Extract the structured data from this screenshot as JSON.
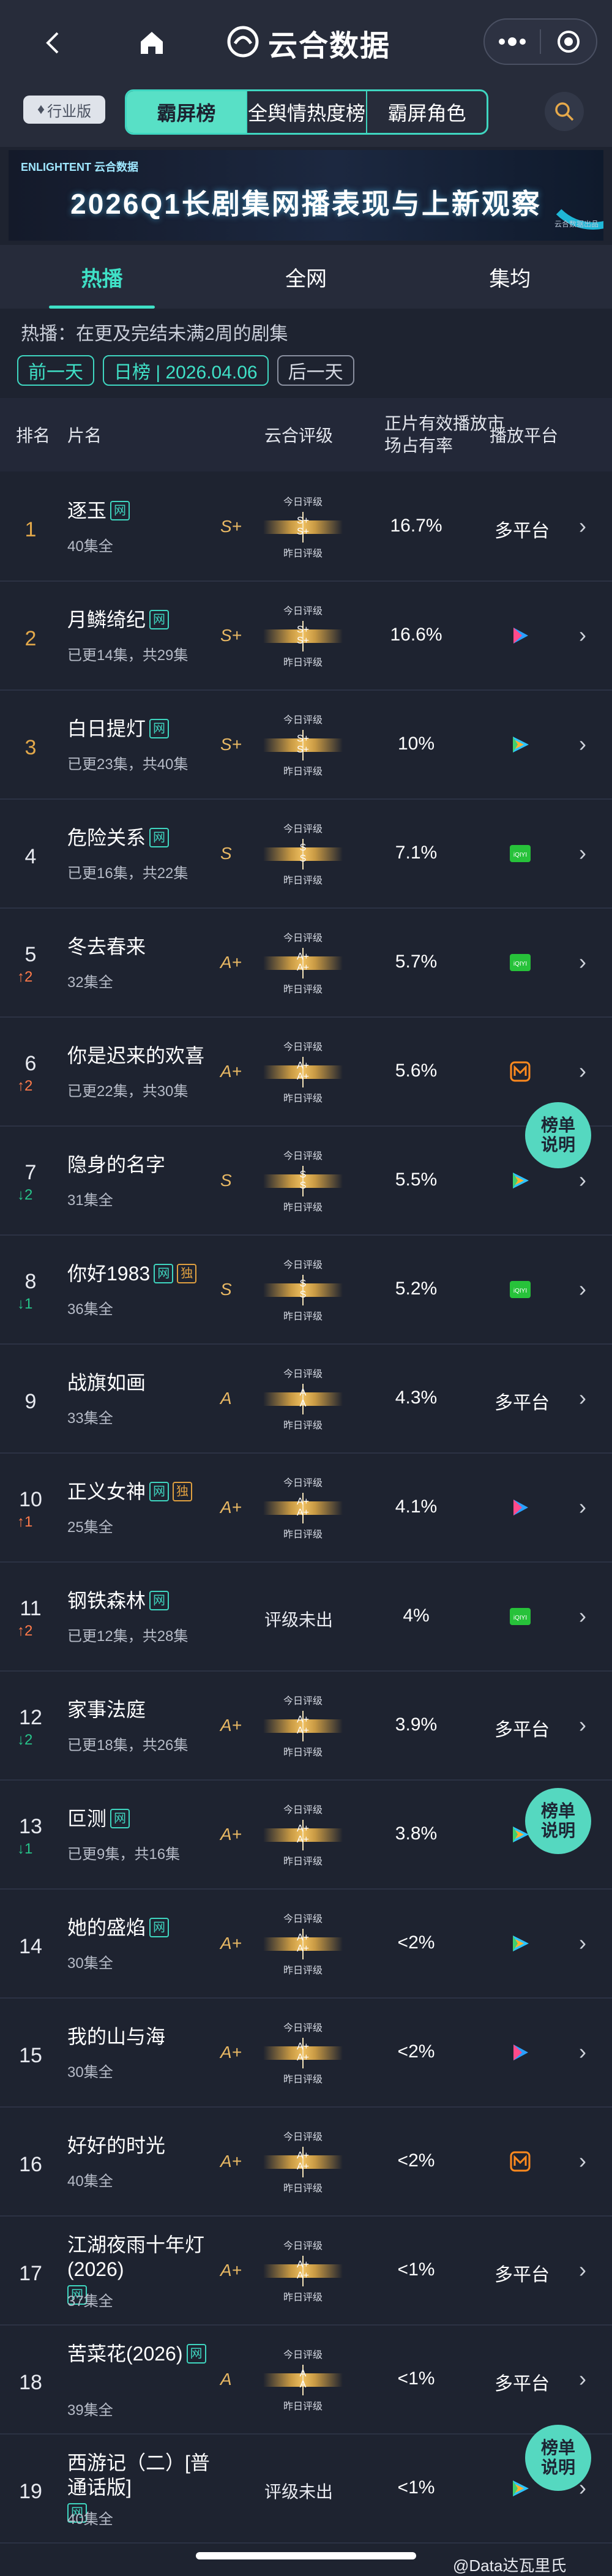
{
  "app": {
    "brand": "云合数据",
    "industry_badge": "行业版",
    "main_tabs": [
      "霸屏榜",
      "全舆情热度榜",
      "霸屏角色"
    ],
    "active_main_tab": 0
  },
  "banner": {
    "logo": "ENLIGHTENT 云合数据",
    "title": "2026Q1长剧集网播表现与上新观察",
    "sub": "云合数据出品"
  },
  "sub_tabs": [
    "热播",
    "全网",
    "集均"
  ],
  "description": "热播：在更及完结未满2周的剧集",
  "date_nav": {
    "prev": "前一天",
    "current": "日榜 | 2026.04.06",
    "next": "后一天"
  },
  "table_headers": {
    "rank": "排名",
    "name": "片名",
    "rating": "云合评级",
    "share": "正片有效播放市场占有率",
    "platform": "播放平台"
  },
  "gauge_labels": {
    "today": "今日评级",
    "yesterday": "昨日评级"
  },
  "floating_button": [
    "榜单",
    "说明"
  ],
  "rows": [
    {
      "rank": "1",
      "title": "逐玉",
      "badges": [
        "网"
      ],
      "episodes": "40集全",
      "grade": "S+",
      "g1": "S+",
      "g2": "S+",
      "share": "16.7%",
      "platform_text": "多平台",
      "platform_icon": "",
      "trend": ""
    },
    {
      "rank": "2",
      "title": "月鳞绮纪",
      "badges": [
        "网"
      ],
      "episodes": "已更14集，共29集",
      "grade": "S+",
      "g1": "S+",
      "g2": "S+",
      "share": "16.6%",
      "platform_text": "",
      "platform_icon": "youku-icon",
      "trend": ""
    },
    {
      "rank": "3",
      "title": "白日提灯",
      "badges": [
        "网"
      ],
      "episodes": "已更23集，共40集",
      "grade": "S+",
      "g1": "S+",
      "g2": "S+",
      "share": "10%",
      "platform_text": "",
      "platform_icon": "tencent-video-icon",
      "trend": ""
    },
    {
      "rank": "4",
      "title": "危险关系",
      "badges": [
        "网"
      ],
      "episodes": "已更16集，共22集",
      "grade": "S",
      "g1": "S",
      "g2": "S",
      "share": "7.1%",
      "platform_text": "",
      "platform_icon": "iqiyi-icon",
      "trend": ""
    },
    {
      "rank": "5",
      "title": "冬去春来",
      "badges": [],
      "episodes": "32集全",
      "grade": "A+",
      "g1": "A+",
      "g2": "A+",
      "share": "5.7%",
      "platform_text": "",
      "platform_icon": "iqiyi-icon",
      "trend": "↑2"
    },
    {
      "rank": "6",
      "title": "你是迟来的欢喜",
      "badges": [],
      "episodes": "已更22集，共30集",
      "grade": "A+",
      "g1": "A+",
      "g2": "A+",
      "share": "5.6%",
      "platform_text": "",
      "platform_icon": "mgtv-icon",
      "trend": "↑2"
    },
    {
      "rank": "7",
      "title": "隐身的名字",
      "badges": [],
      "episodes": "31集全",
      "grade": "S",
      "g1": "S",
      "g2": "S",
      "share": "5.5%",
      "platform_text": "",
      "platform_icon": "tencent-video-icon",
      "trend": "↓2"
    },
    {
      "rank": "8",
      "title": "你好1983",
      "badges": [
        "网",
        "独"
      ],
      "episodes": "36集全",
      "grade": "S",
      "g1": "S",
      "g2": "S",
      "share": "5.2%",
      "platform_text": "",
      "platform_icon": "iqiyi-icon",
      "trend": "↓1"
    },
    {
      "rank": "9",
      "title": "战旗如画",
      "badges": [],
      "episodes": "33集全",
      "grade": "A",
      "g1": "A",
      "g2": "A",
      "share": "4.3%",
      "platform_text": "多平台",
      "platform_icon": "",
      "trend": ""
    },
    {
      "rank": "10",
      "title": "正义女神",
      "badges": [
        "网",
        "独"
      ],
      "episodes": "25集全",
      "grade": "A+",
      "g1": "A+",
      "g2": "A+",
      "share": "4.1%",
      "platform_text": "",
      "platform_icon": "youku-icon",
      "trend": "↑1"
    },
    {
      "rank": "11",
      "title": "钢铁森林",
      "badges": [
        "网"
      ],
      "episodes": "已更12集，共28集",
      "grade": "",
      "g1": "",
      "g2": "",
      "unrated": "评级未出",
      "share": "4%",
      "platform_text": "",
      "platform_icon": "iqiyi-icon",
      "trend": "↑2"
    },
    {
      "rank": "12",
      "title": "家事法庭",
      "badges": [],
      "episodes": "已更18集，共26集",
      "grade": "A+",
      "g1": "A+",
      "g2": "A+",
      "share": "3.9%",
      "platform_text": "多平台",
      "platform_icon": "",
      "trend": "↓2"
    },
    {
      "rank": "13",
      "title": "叵测",
      "badges": [
        "网"
      ],
      "episodes": "已更9集，共16集",
      "grade": "A+",
      "g1": "A+",
      "g2": "A+",
      "share": "3.8%",
      "platform_text": "",
      "platform_icon": "tencent-video-icon",
      "trend": "↓1"
    },
    {
      "rank": "14",
      "title": "她的盛焰",
      "badges": [
        "网"
      ],
      "episodes": "30集全",
      "grade": "A+",
      "g1": "A+",
      "g2": "A+",
      "share": "<2%",
      "platform_text": "",
      "platform_icon": "tencent-video-icon",
      "trend": ""
    },
    {
      "rank": "15",
      "title": "我的山与海",
      "badges": [],
      "episodes": "30集全",
      "grade": "A+",
      "g1": "A+",
      "g2": "A+",
      "share": "<2%",
      "platform_text": "",
      "platform_icon": "youku-icon",
      "trend": ""
    },
    {
      "rank": "16",
      "title": "好好的时光",
      "badges": [],
      "episodes": "40集全",
      "grade": "A+",
      "g1": "A+",
      "g2": "A+",
      "share": "<2%",
      "platform_text": "",
      "platform_icon": "mgtv-icon",
      "trend": ""
    },
    {
      "rank": "17",
      "title": "江湖夜雨十年灯(2026)",
      "badges": [
        "网"
      ],
      "episodes": "37集全",
      "grade": "A+",
      "g1": "A+",
      "g2": "A+",
      "share": "<1%",
      "platform_text": "多平台",
      "platform_icon": "",
      "trend": ""
    },
    {
      "rank": "18",
      "title": "苦菜花(2026)",
      "badges": [
        "网"
      ],
      "episodes": "39集全",
      "grade": "A",
      "g1": "A",
      "g2": "A",
      "share": "<1%",
      "platform_text": "多平台",
      "platform_icon": "",
      "trend": ""
    },
    {
      "rank": "19",
      "title": "西游记（二）[普通话版]",
      "badges": [
        "网"
      ],
      "episodes": "40集全",
      "grade": "",
      "g1": "",
      "g2": "",
      "unrated": "评级未出",
      "share": "<1%",
      "platform_text": "",
      "platform_icon": "tencent-video-icon",
      "trend": ""
    }
  ],
  "footer": {
    "weibo": "@Data达瓦里氏"
  },
  "colors": {
    "accent": "#3fd6c0",
    "gold": "#e2a84a",
    "bg": "#1e2330"
  }
}
